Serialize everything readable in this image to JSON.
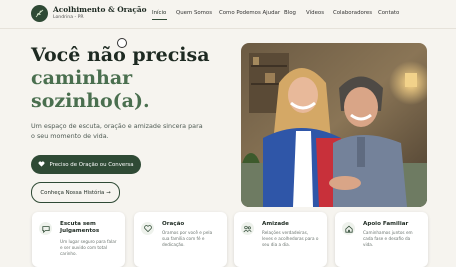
{
  "header": {
    "brand": {
      "name": "Acolhimento & Oração",
      "location": "Londrina - PR",
      "logo_icon": "olive-branch-icon"
    },
    "nav": [
      {
        "label": "Início",
        "active": true
      },
      {
        "label": "Quem Somos",
        "active": false
      },
      {
        "label": "Como Podemos Ajudar",
        "active": false
      },
      {
        "label": "Blog",
        "active": false
      },
      {
        "label": "Vídeos",
        "active": false
      },
      {
        "label": "Colaboradores",
        "active": false
      },
      {
        "label": "Contato",
        "active": false
      }
    ]
  },
  "hero": {
    "title_line1": "Você não precisa",
    "title_line2": "caminhar",
    "title_line3": "sozinho(a).",
    "subtitle_line1": "Um espaço de escuta, oração e amizade sincera para",
    "subtitle_line2": "o seu momento de vida.",
    "primary_button": {
      "label": "Preciso de Oração ou Conversa",
      "icon": "heart-icon"
    },
    "secondary_button": {
      "label": "Conheça Nossa História →"
    },
    "image_icon": "couple-photo"
  },
  "cards": [
    {
      "icon": "chat-bubble-icon",
      "title_line1": "Escuta sem",
      "title_line2": "Julgamentos",
      "text_line1": "Um lugar seguro para falar",
      "text_line2": "e ser ouvido com total",
      "text_line3": "carinho."
    },
    {
      "icon": "heart-icon",
      "title_line1": "Oração",
      "text_line1": "Oramos por você e pela",
      "text_line2": "sua família com fé e",
      "text_line3": "dedicação."
    },
    {
      "icon": "people-icon",
      "title_line1": "Amizade",
      "text_line1": "Relações verdadeiras,",
      "text_line2": "leves e acolhedoras para o",
      "text_line3": "seu dia a dia."
    },
    {
      "icon": "home-icon",
      "title_line1": "Apoio Familiar",
      "text_line1": "Caminhamos juntos em",
      "text_line2": "cada fase e desafio da",
      "text_line3": "vida."
    }
  ],
  "colors": {
    "primary": "#2f4a35",
    "accent": "#4a6f4f",
    "background": "#f6f4ef"
  }
}
